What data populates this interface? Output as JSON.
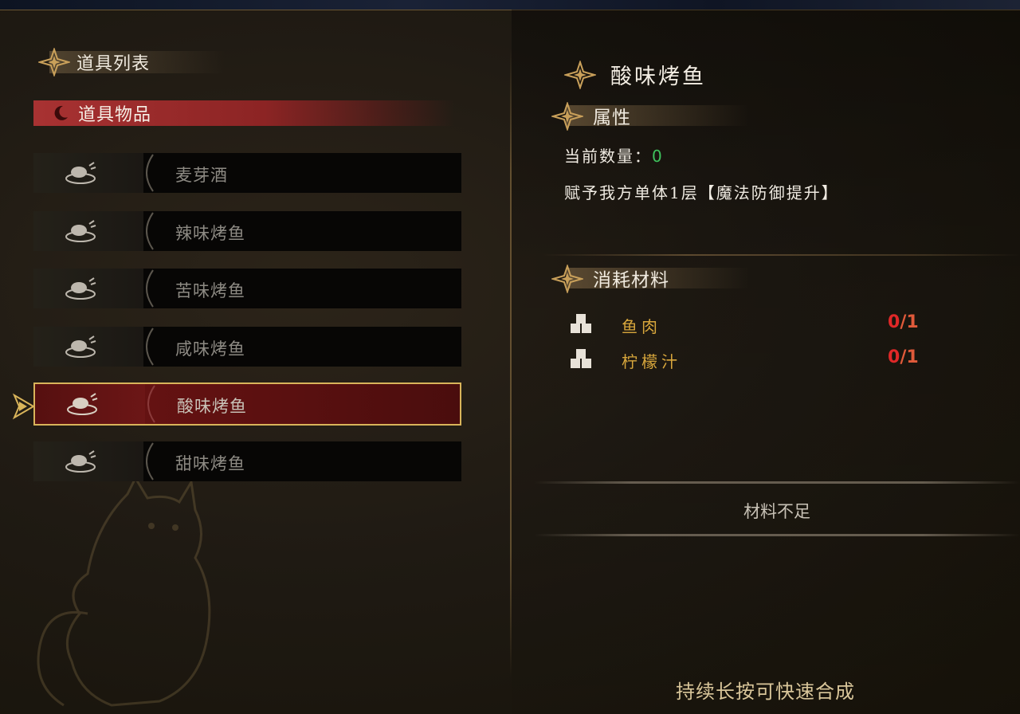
{
  "left": {
    "header": "道具列表",
    "category": "道具物品",
    "items": [
      {
        "name": "麦芽酒",
        "selected": false
      },
      {
        "name": "辣味烤鱼",
        "selected": false
      },
      {
        "name": "苦味烤鱼",
        "selected": false
      },
      {
        "name": "咸味烤鱼",
        "selected": false
      },
      {
        "name": "酸味烤鱼",
        "selected": true
      },
      {
        "name": "甜味烤鱼",
        "selected": false
      }
    ]
  },
  "detail": {
    "title": "酸味烤鱼",
    "attr_header": "属性",
    "qty_label": "当前数量：",
    "qty_value": "0",
    "effect": "赋予我方单体1层【魔法防御提升】",
    "mat_header": "消耗材料",
    "materials": [
      {
        "name": "鱼肉",
        "have": "0",
        "need": "/1"
      },
      {
        "name": "柠檬汁",
        "have": "0",
        "need": "/1"
      }
    ],
    "craft_status": "材料不足",
    "hint": "持续长按可快速合成"
  },
  "colors": {
    "accent_red": "#a83232",
    "selected_border": "#d9b45a",
    "material_gold": "#d9a73c",
    "lack_red": "#e02828",
    "qty_green": "#3ec25c"
  },
  "icons": {
    "header": "star-ornament-icon",
    "category": "crescent-moon-icon",
    "item": "roast-fish-dish-icon",
    "material": "cubes-icon",
    "pointer": "selection-pointer-icon"
  }
}
